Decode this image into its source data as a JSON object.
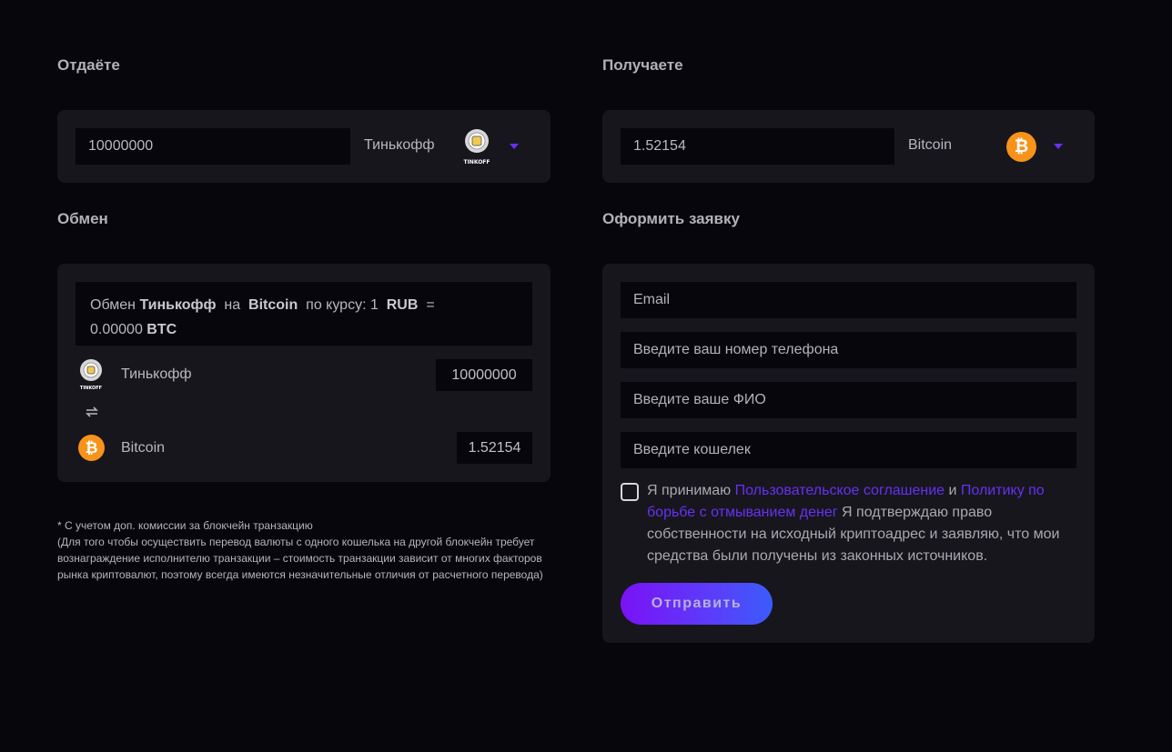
{
  "give": {
    "heading": "Отдаёте",
    "amount": "10000000",
    "currency": "Тинькофф",
    "logo_text": "TINKOFF",
    "icon": "tinkoff-logo"
  },
  "receive": {
    "heading": "Получаете",
    "amount": "1.52154",
    "currency": "Bitcoin",
    "icon": "bitcoin-logo"
  },
  "exchange": {
    "heading": "Обмен",
    "rate_prefix": "Обмен",
    "rate_from": "Тинькофф",
    "rate_on": "на",
    "rate_to": "Bitcoin",
    "rate_mid": "по курсу: 1",
    "rate_unit": "RUB",
    "rate_eq": "=",
    "rate_value": "0.00000",
    "rate_unit2": "BTC",
    "from_name": "Тинькофф",
    "from_value": "10000000",
    "to_name": "Bitcoin",
    "to_value": "1.52154",
    "from_logo_text": "TINKOFF"
  },
  "note": {
    "line1": "* С учетом доп. комиссии за блокчейн транзакцию",
    "line2": "(Для того чтобы осуществить перевод валюты с одного кошелька на другой блокчейн требует вознаграждение исполнителю транзакции – стоимость транзакции зависит от многих факторов рынка криптовалют, поэтому всегда имеются незначительные отличия от расчетного перевода)"
  },
  "order": {
    "heading": "Оформить заявку",
    "email_placeholder": "Email",
    "phone_placeholder": "Введите ваш номер телефона",
    "name_placeholder": "Введите ваше ФИО",
    "wallet_placeholder": "Введите кошелек",
    "agree_prefix": "Я принимаю",
    "agree_link1": "Пользовательское соглашение",
    "agree_and": "и",
    "agree_link2": "Политику по борьбе с отмыванием денег",
    "agree_suffix": "Я подтверждаю право собственности на исходный криптоадрес и заявляю, что мои средства были получены из законных источников.",
    "submit_label": "Отправить"
  },
  "colors": {
    "background": "#07060d",
    "card": "#17161d",
    "accent": "#6631f3",
    "bitcoin": "#f7931a"
  }
}
